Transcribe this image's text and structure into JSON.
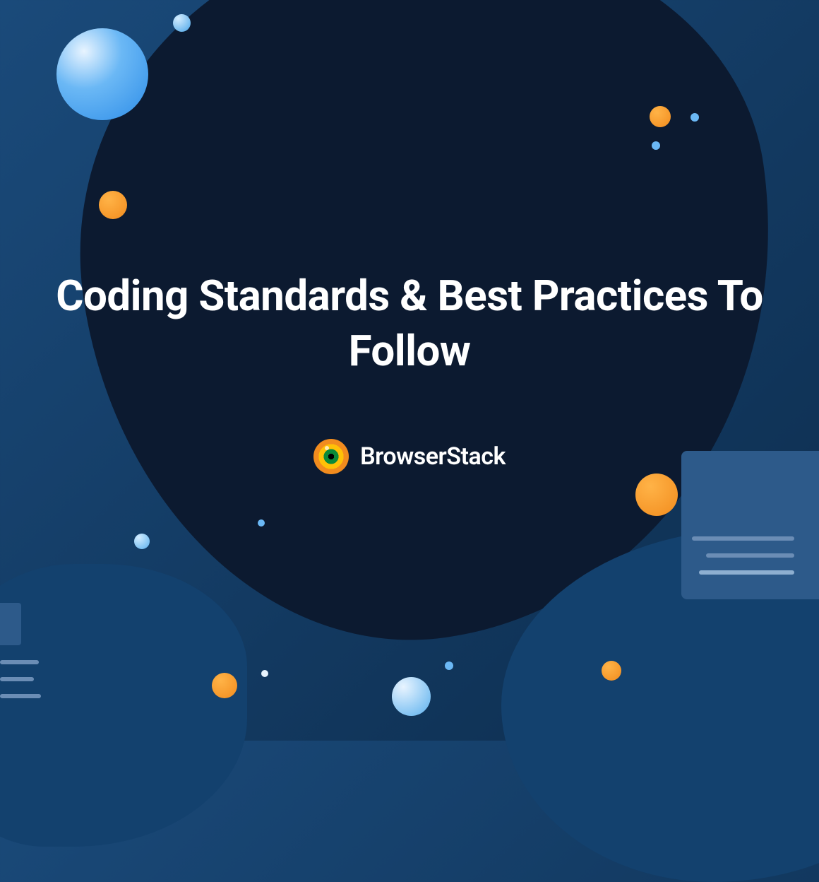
{
  "title": "Coding Standards & Best Practices To Follow",
  "brand": {
    "name": "BrowserStack",
    "icon": "browserstack-logo-icon"
  },
  "colors": {
    "background_dark": "#0c1a30",
    "background_mid": "#13416e",
    "accent_orange": "#f28c1e",
    "accent_blue": "#5ab0ee",
    "text": "#ffffff"
  }
}
